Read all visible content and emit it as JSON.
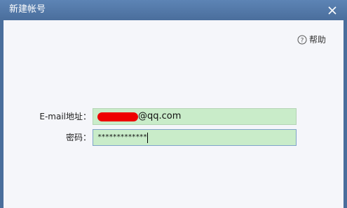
{
  "window": {
    "title": "新建帐号",
    "close_icon": "close-icon"
  },
  "help": {
    "icon": "help-circle-icon",
    "label": "帮助"
  },
  "form": {
    "email": {
      "label": "E-mail地址：",
      "value_suffix": "@qq.com",
      "redacted": true
    },
    "password": {
      "label": "密码：",
      "value_masked": "*************"
    }
  },
  "colors": {
    "titlebar": "#4a6e9c",
    "content_bg": "#f5f6fa",
    "input_bg": "#c9ecc9",
    "redaction": "#ee0000",
    "focus_border": "#7fa3c8"
  }
}
